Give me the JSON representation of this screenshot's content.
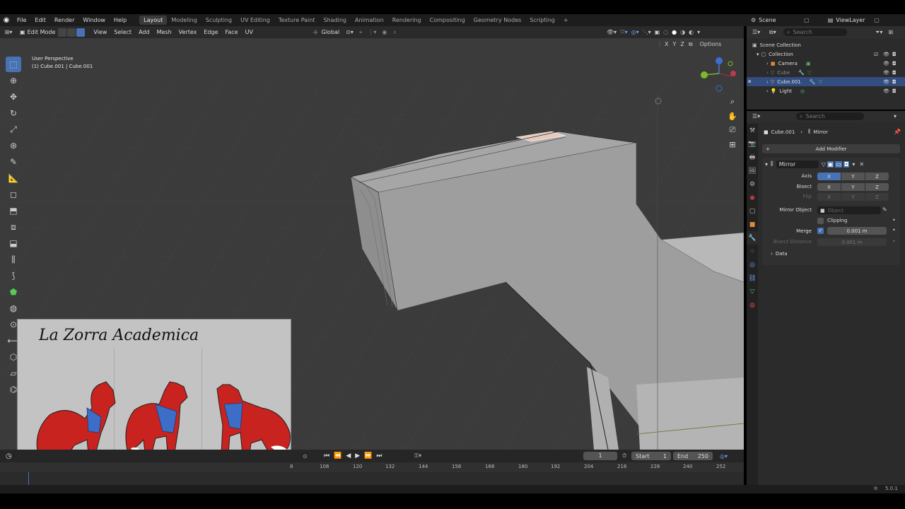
{
  "topbar": {
    "menus": [
      "File",
      "Edit",
      "Render",
      "Window",
      "Help"
    ],
    "workspaces": [
      "Layout",
      "Modeling",
      "Sculpting",
      "UV Editing",
      "Texture Paint",
      "Shading",
      "Animation",
      "Rendering",
      "Compositing",
      "Geometry Nodes",
      "Scripting"
    ],
    "active_workspace": "Layout",
    "add_tab": "+",
    "scene": "Scene",
    "viewlayer": "ViewLayer"
  },
  "viewport_header": {
    "mode": "Edit Mode",
    "menus": [
      "View",
      "Select",
      "Add",
      "Mesh",
      "Vertex",
      "Edge",
      "Face",
      "UV"
    ],
    "orientation": "Global",
    "options": "Options",
    "axes": [
      "X",
      "Y",
      "Z"
    ]
  },
  "viewport": {
    "perspective": "User Perspective",
    "object_info": "(1) Cube.001 | Cube.001"
  },
  "outliner": {
    "search_placeholder": "Search",
    "root": "Scene Collection",
    "collection": "Collection",
    "items": [
      {
        "name": "Camera",
        "selected": false,
        "dim": false
      },
      {
        "name": "Cube",
        "selected": false,
        "dim": true
      },
      {
        "name": "Cube.001",
        "selected": true,
        "dim": false
      },
      {
        "name": "Light",
        "selected": false,
        "dim": false
      }
    ]
  },
  "properties": {
    "search_placeholder": "Search",
    "breadcrumb_object": "Cube.001",
    "breadcrumb_modifier": "Mirror",
    "add_modifier": "Add Modifier",
    "modifier_name": "Mirror",
    "axis_label": "Axis",
    "bisect_label": "Bisect",
    "flip_label": "Flip",
    "xyz": [
      "X",
      "Y",
      "Z"
    ],
    "mirror_object_label": "Mirror Object",
    "mirror_object_placeholder": "Object",
    "clipping_label": "Clipping",
    "merge_label": "Merge",
    "merge_value": "0.001 m",
    "bisect_distance_label": "Bisect Distance",
    "bisect_distance_value": "0.001 m",
    "data_label": "Data"
  },
  "timeline": {
    "current_frame": "1",
    "start_label": "Start",
    "start_value": "1",
    "end_label": "End",
    "end_value": "250",
    "ticks": [
      "8",
      "108",
      "120",
      "132",
      "144",
      "156",
      "168",
      "180",
      "192",
      "204",
      "216",
      "228",
      "240",
      "252"
    ]
  },
  "statusbar": {
    "version": "5.0.1"
  },
  "overlay_image": {
    "handwritten_title": "La Zorra Academica"
  },
  "colors": {
    "accent": "#4772b3",
    "selection": "#334d80",
    "viewport_bg": "#3c3c3c",
    "panel_bg": "#2b2b2b"
  }
}
